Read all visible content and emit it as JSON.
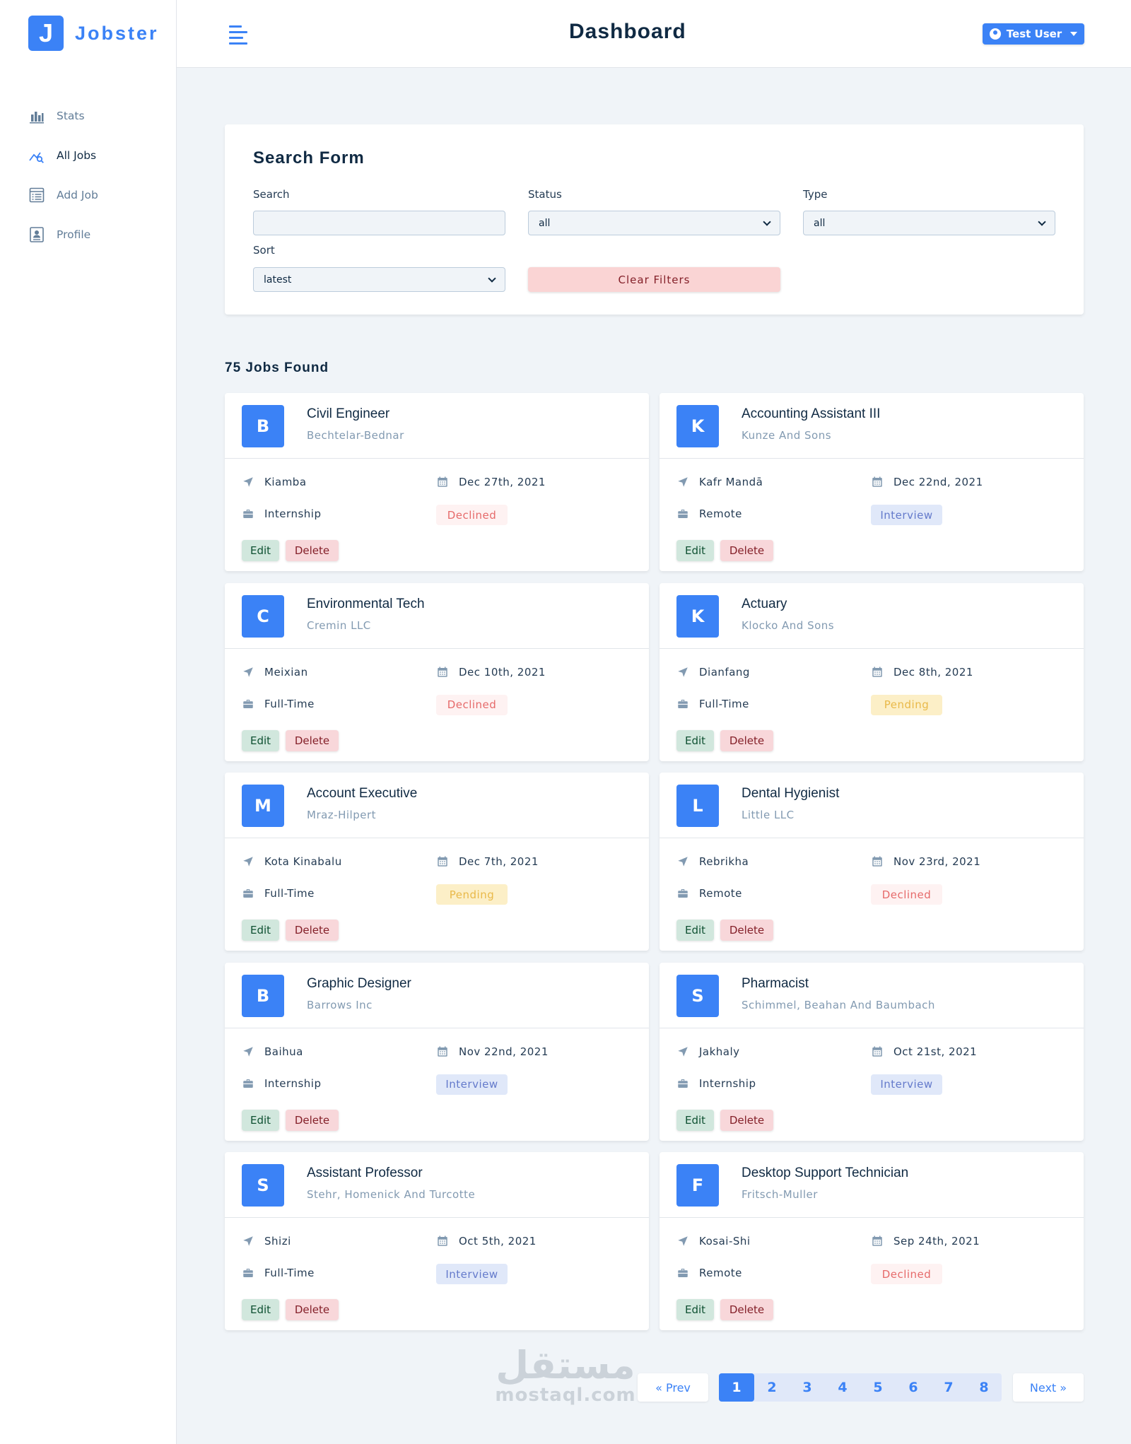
{
  "app": {
    "logo_letter": "J",
    "logo_text": "Jobster"
  },
  "header": {
    "title": "Dashboard",
    "user_label": "Test User"
  },
  "sidebar": {
    "items": [
      {
        "label": "Stats",
        "icon": "bar-chart-icon",
        "active": false
      },
      {
        "label": "All Jobs",
        "icon": "query-stats-icon",
        "active": true
      },
      {
        "label": "Add Job",
        "icon": "form-icon",
        "active": false
      },
      {
        "label": "Profile",
        "icon": "id-card-icon",
        "active": false
      }
    ]
  },
  "search_form": {
    "title": "Search Form",
    "search_label": "Search",
    "search_value": "",
    "status_label": "Status",
    "status_value": "all",
    "type_label": "Type",
    "type_value": "all",
    "sort_label": "Sort",
    "sort_value": "latest",
    "clear_label": "Clear Filters"
  },
  "jobs_found": "75 Jobs Found",
  "jobs": [
    {
      "letter": "B",
      "position": "Civil Engineer",
      "company": "Bechtelar-Bednar",
      "location": "Kiamba",
      "date": "Dec 27th, 2021",
      "type": "Internship",
      "status": "Declined"
    },
    {
      "letter": "K",
      "position": "Accounting Assistant III",
      "company": "Kunze And Sons",
      "location": "Kafr Mandā",
      "date": "Dec 22nd, 2021",
      "type": "Remote",
      "status": "Interview"
    },
    {
      "letter": "C",
      "position": "Environmental Tech",
      "company": "Cremin LLC",
      "location": "Meixian",
      "date": "Dec 10th, 2021",
      "type": "Full-Time",
      "status": "Declined"
    },
    {
      "letter": "K",
      "position": "Actuary",
      "company": "Klocko And Sons",
      "location": "Dianfang",
      "date": "Dec 8th, 2021",
      "type": "Full-Time",
      "status": "Pending"
    },
    {
      "letter": "M",
      "position": "Account Executive",
      "company": "Mraz-Hilpert",
      "location": "Kota Kinabalu",
      "date": "Dec 7th, 2021",
      "type": "Full-Time",
      "status": "Pending"
    },
    {
      "letter": "L",
      "position": "Dental Hygienist",
      "company": "Little LLC",
      "location": "Rebrikha",
      "date": "Nov 23rd, 2021",
      "type": "Remote",
      "status": "Declined"
    },
    {
      "letter": "B",
      "position": "Graphic Designer",
      "company": "Barrows Inc",
      "location": "Baihua",
      "date": "Nov 22nd, 2021",
      "type": "Internship",
      "status": "Interview"
    },
    {
      "letter": "S",
      "position": "Pharmacist",
      "company": "Schimmel, Beahan And Baumbach",
      "location": "Jakhaly",
      "date": "Oct 21st, 2021",
      "type": "Internship",
      "status": "Interview"
    },
    {
      "letter": "S",
      "position": "Assistant Professor",
      "company": "Stehr, Homenick And Turcotte",
      "location": "Shizi",
      "date": "Oct 5th, 2021",
      "type": "Full-Time",
      "status": "Interview"
    },
    {
      "letter": "F",
      "position": "Desktop Support Technician",
      "company": "Fritsch-Muller",
      "location": "Kosai-Shi",
      "date": "Sep 24th, 2021",
      "type": "Remote",
      "status": "Declined"
    }
  ],
  "job_actions": {
    "edit_label": "Edit",
    "delete_label": "Delete"
  },
  "pagination": {
    "prev_label": "« Prev",
    "next_label": "Next »",
    "pages": [
      "1",
      "2",
      "3",
      "4",
      "5",
      "6",
      "7",
      "8"
    ],
    "current": "1"
  },
  "watermark": {
    "arabic": "مستقل",
    "latin": "mostaql.com"
  },
  "colors": {
    "primary": "#3b82f6",
    "background": "#f0f4f8",
    "declined": "#e66a6a",
    "interview": "#647acb",
    "pending": "#e9b949"
  }
}
